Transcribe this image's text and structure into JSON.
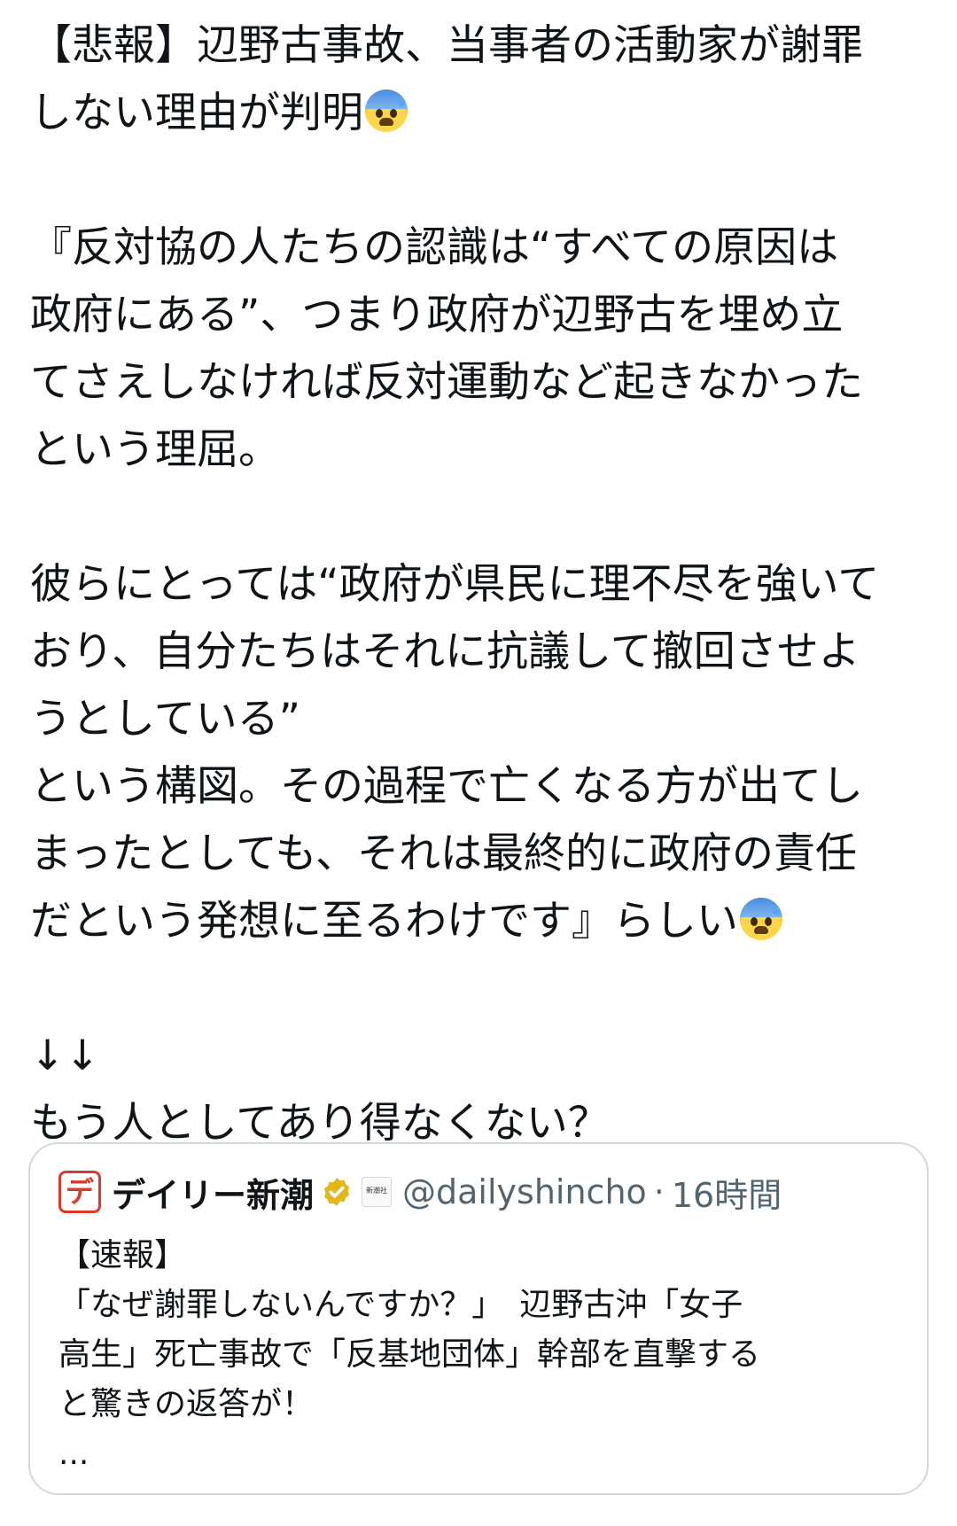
{
  "post": {
    "lines": [
      "【悲報】辺野古事故、当事者の活動家が謝罪",
      "しない理由が判明",
      "",
      "『反対協の人たちの認識は“すべての原因は",
      "政府にある”、つまり政府が辺野古を埋め立",
      "てさえしなければ反対運動など起きなかった",
      "という理屈。",
      "",
      "彼らにとっては“政府が県民に理不尽を強いて",
      "おり、自分たちはそれに抗議して撤回させよ",
      "うとしている”",
      "という構図。その過程で亡くなる方が出てし",
      "まったとしても、それは最終的に政府の責任",
      "だという発想に至るわけです』らしい",
      "",
      "↓↓",
      "もう人としてあり得なくない？"
    ],
    "emoji": "anxious-face-with-sweat"
  },
  "quote": {
    "logo_text": "デ",
    "account_name": "デイリー新潮",
    "badge_text": "新潮社",
    "handle": "@dailyshincho",
    "dot": "·",
    "time": "16時間",
    "lines": [
      "【速報】",
      "「なぜ謝罪しないんですか？」　辺野古沖「女子",
      "高生」死亡事故で「反基地団体」幹部を直撃する",
      "と驚きの返答が！",
      "..."
    ]
  },
  "colors": {
    "text": "#0f1419",
    "secondary": "#536471",
    "border": "#cfd9de",
    "brand_red": "#d83b2b",
    "verified_gold": "#e2b719"
  }
}
